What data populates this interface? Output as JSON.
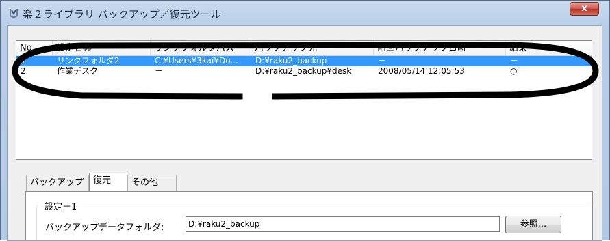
{
  "window": {
    "title": "楽２ライブラリ バックアップ／復元ツール",
    "close_label": "x",
    "app_icon": "raku2-app-icon"
  },
  "list": {
    "columns": [
      "No",
      "設定名称",
      "リンクフォルダパス",
      "バックアップ先",
      "前回バックアップ日時",
      "結果"
    ],
    "rows": [
      {
        "no": "1",
        "name": "リンクフォルダ2",
        "link_path": "C:¥Users¥3kai¥Do...",
        "dest": "D:¥raku2_backup",
        "last": "－",
        "result": "－",
        "selected": true
      },
      {
        "no": "2",
        "name": "作業デスク",
        "link_path": "－",
        "dest": "D:¥raku2_backup¥desk",
        "last": "2008/05/14 12:05:53",
        "result": "○",
        "selected": false
      }
    ]
  },
  "tabs": [
    "バックアップ",
    "復元",
    "その他"
  ],
  "active_tab": "復元",
  "settings": {
    "group_title": "設定－1",
    "folder_label": "バックアップデータフォルダ:",
    "folder_value": "D:¥raku2_backup",
    "browse_label": "参照..."
  },
  "colors": {
    "selection": "#3399ff",
    "annotation": "#000000"
  }
}
